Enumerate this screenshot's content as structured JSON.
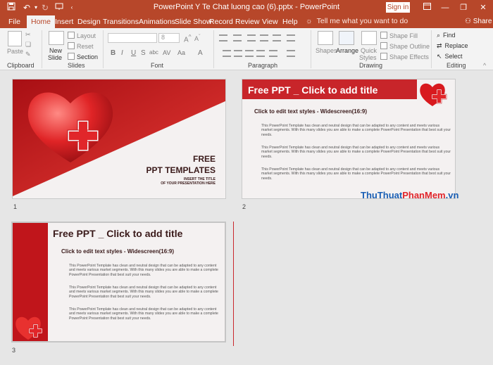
{
  "window": {
    "title": "PowerPoint Y Te Chat luong cao (6).pptx  -  PowerPoint",
    "sign_in": "Sign in",
    "quick_access": [
      "save-icon",
      "undo-icon",
      "redo-icon",
      "present-icon"
    ]
  },
  "tabs": [
    "File",
    "Home",
    "Insert",
    "Design",
    "Transitions",
    "Animations",
    "Slide Show",
    "Record",
    "Review",
    "View",
    "Help"
  ],
  "active_tab": "Home",
  "tell_me": "Tell me what you want to do",
  "share": "Share",
  "ribbon": {
    "groups": [
      "Clipboard",
      "Slides",
      "Font",
      "Paragraph",
      "Drawing",
      "Editing"
    ],
    "clipboard": {
      "paste": "Paste"
    },
    "slides": {
      "new_slide_1": "New",
      "new_slide_2": "Slide",
      "layout": "Layout",
      "reset": "Reset",
      "section": "Section"
    },
    "font": {
      "size": "8",
      "bold": "B",
      "italic": "I",
      "underline": "U",
      "strike": "S",
      "shadow": "abc",
      "spacing": "AV",
      "case": "Aa",
      "color": "A"
    },
    "drawing": {
      "shapes": "Shapes",
      "arrange": "Arrange",
      "quick_styles_1": "Quick",
      "quick_styles_2": "Styles",
      "shape_fill": "Shape Fill",
      "shape_outline": "Shape Outline",
      "shape_effects": "Shape Effects"
    },
    "editing": {
      "find": "Find",
      "replace": "Replace",
      "select": "Select"
    }
  },
  "slides": [
    {
      "number": "1",
      "title_1": "FREE",
      "title_2": "PPT TEMPLATES",
      "sub_1": "INSERT THE TITLE",
      "sub_2": "OF YOUR PRESENTATION HERE"
    },
    {
      "number": "2",
      "title": "Free PPT _ Click to add title",
      "subtitle": "Click to edit text styles - Widescreen(16:9)",
      "paragraphs": [
        "This PowerPoint Template has clean and neutral design that can be adapted to any content and meets various market segments. With this many slides you are able to make a complete PowerPoint Presentation that best suit your needs.",
        "This PowerPoint Template has clean and neutral design that can be adapted to any content and meets various market segments. With this many slides you are able to make a complete PowerPoint Presentation that best suit your needs.",
        "This PowerPoint Template has clean and neutral design that can be adapted to any content and meets various market segments. With this many slides you are able to make a complete PowerPoint Presentation that best suit your needs."
      ]
    },
    {
      "number": "3",
      "title": "Free PPT _ Click to add title",
      "subtitle": "Click to edit text styles - Widescreen(16:9)",
      "paragraphs": [
        "This PowerPoint Template has clean and neutral design that can be adapted to any content and meets various market segments. With this many slides you are able to make a complete PowerPoint Presentation that best suit your needs.",
        "This PowerPoint Template has clean and neutral design that can be adapted to any content and meets various market segments. With this many slides you are able to make a complete PowerPoint Presentation that best suit your needs.",
        "This PowerPoint Template has clean and neutral design that can be adapted to any content and meets various market segments. With this many slides you are able to make a complete PowerPoint Presentation that best suit your needs."
      ]
    }
  ],
  "watermark": {
    "part1": "ThuThuat",
    "part2": "PhanMem",
    "part3": ".vn"
  },
  "colors": {
    "accent": "#b7472a",
    "slide_red": "#c8252a"
  }
}
